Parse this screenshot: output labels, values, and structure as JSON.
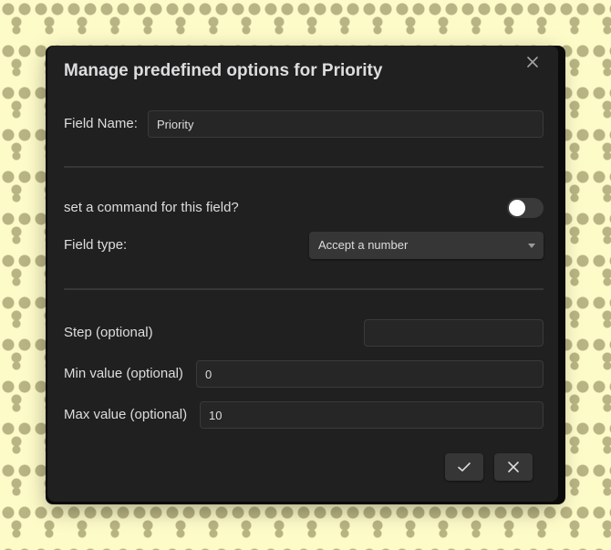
{
  "dialog": {
    "title": "Manage predefined options for Priority",
    "field_name_label": "Field Name:",
    "field_name_value": "Priority",
    "command_label": "set a command for this field?",
    "command_enabled": false,
    "field_type_label": "Field type:",
    "field_type_value": "Accept a number",
    "step_label": "Step (optional)",
    "step_value": "",
    "min_label": "Min value (optional)",
    "min_value": "0",
    "max_label": "Max value (optional)",
    "max_value": "10"
  },
  "icons": {
    "close": "close-icon",
    "confirm": "check-icon",
    "cancel": "x-icon",
    "dropdown": "chevron-down-icon"
  },
  "colors": {
    "background": "#fdfbc8",
    "pattern": "#b9b483",
    "modal": "#202020",
    "text": "#dcddde"
  }
}
